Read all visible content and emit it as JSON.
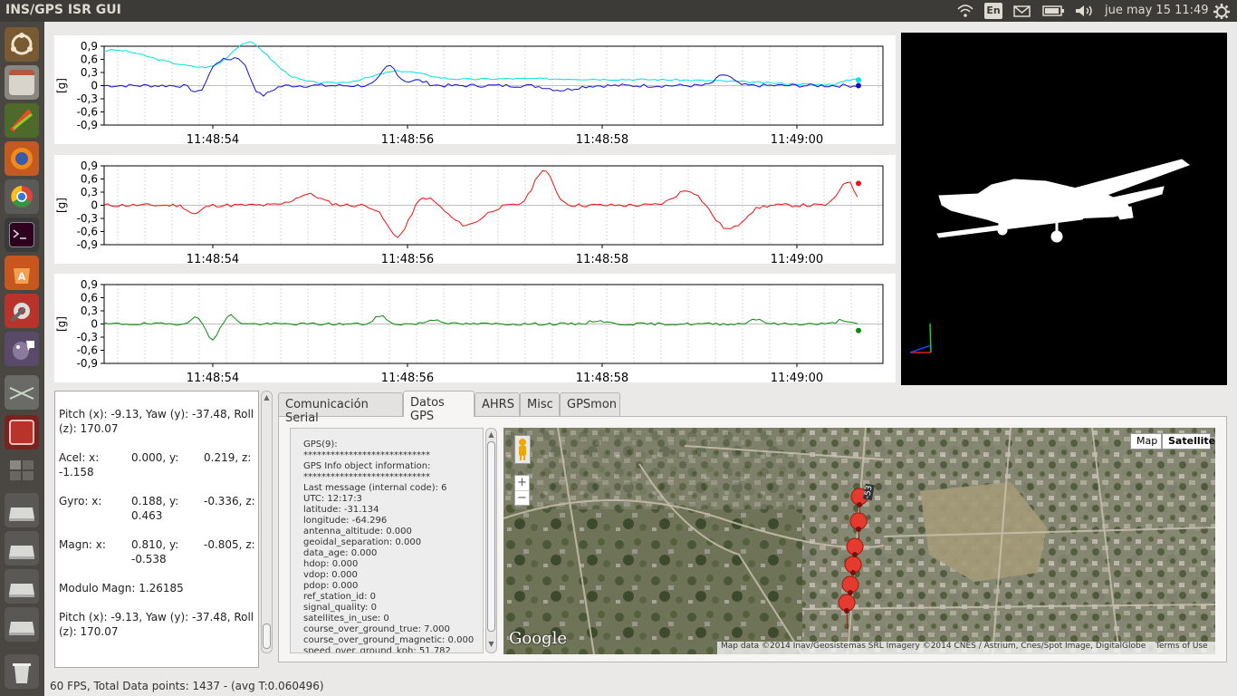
{
  "window": {
    "title": "INS/GPS ISR GUI"
  },
  "topbar": {
    "keyboard_layout": "En",
    "datetime": "jue may 15 11:49",
    "icons": [
      "wifi-icon",
      "mail-icon",
      "battery-icon",
      "volume-icon",
      "settings-gear-icon"
    ]
  },
  "launcher": {
    "items": [
      "ubuntu-dash-icon",
      "files-icon",
      "paint-icon",
      "firefox-icon",
      "chrome-icon",
      "terminal-icon",
      "software-center-icon",
      "system-settings-icon",
      "pidgin-icon",
      "scanner-icon",
      "workspace-app-icon",
      "workspace-switcher-icon",
      "drive-icon",
      "drive-icon",
      "drive-icon",
      "drive-icon",
      "trash-icon"
    ]
  },
  "plots": [
    {
      "ylabel": "[g]",
      "yticks": [
        "0,9",
        "0,6",
        "0,3",
        "0",
        "-0,3",
        "-0,6",
        "-0,9"
      ],
      "xticks": [
        "11:48:54",
        "11:48:56",
        "11:48:58",
        "11:49:00"
      ],
      "series_colors": [
        "#00e0e0",
        "#1010cc"
      ]
    },
    {
      "ylabel": "[g]",
      "yticks": [
        "0,9",
        "0,6",
        "0,3",
        "0",
        "-0,3",
        "-0,6",
        "-0,9"
      ],
      "xticks": [
        "11:48:54",
        "11:48:56",
        "11:48:58",
        "11:49:00"
      ],
      "series_colors": [
        "#ee1111"
      ]
    },
    {
      "ylabel": "[g]",
      "yticks": [
        "0,9",
        "0,6",
        "0,3",
        "0",
        "-0,3",
        "-0,6",
        "-0,9"
      ],
      "xticks": [
        "11:48:54",
        "11:48:56",
        "11:48:58",
        "11:49:00"
      ],
      "series_colors": [
        "#0a8a0a"
      ]
    }
  ],
  "info": {
    "pyr1_a": "Pitch (x): -9.13, Yaw (y): -37.48, Roll",
    "pyr1_b": "(z): 170.07",
    "acel_label": "Acel: x:",
    "acel_x": "0.000, y:",
    "acel_y": "0.219, z:",
    "acel_z": "-1.158",
    "gyro_label": "Gyro: x:",
    "gyro_x": "0.188, y:",
    "gyro_y": "-0.336, z:",
    "gyro_z": "0.463",
    "magn_label": "Magn: x:",
    "magn_x": "0.810, y:",
    "magn_y": "-0.805, z:",
    "magn_z": "-0.538",
    "modulo": "Modulo Magn: 1.26185",
    "pyr2_a": "Pitch (x): -9.13, Yaw (y): -37.48, Roll",
    "pyr2_b": "(z): 170.07"
  },
  "tabs": [
    "Comunicación Serial",
    "Datos GPS",
    "AHRS",
    "Misc",
    "GPSmon"
  ],
  "gps_lines": [
    "GPS(9):",
    "****************************",
    "GPS Info object information:",
    "****************************",
    "Last message (internal code): 6",
    "UTC: 12:17:3",
    "latitude: -31.134",
    "longitude: -64.296",
    "antenna_altitude: 0.000",
    "geoidal_separation: 0.000",
    "data_age: 0.000",
    "hdop: 0.000",
    "vdop: 0.000",
    "pdop: 0.000",
    "ref_station_id: 0",
    "signal_quality: 0",
    "satellites_in_use: 0",
    "course_over_ground_true: 7.000",
    "course_over_ground_magnetic: 0.000",
    "speed_over_ground_kph: 51.782"
  ],
  "map": {
    "type_map": "Map",
    "type_satellite": "Satellite",
    "zoom_in": "+",
    "zoom_out": "−",
    "road_label": "-53",
    "logo": "Google",
    "attribution": "Map data ©2014 Inav/Geosistemas SRL Imagery ©2014 CNES / Astrium, Cnes/Spot Image, DigitalGlobe",
    "terms": "Terms of Use"
  },
  "status": "60 FPS, Total Data points: 1437 - (avg T:0.060496)"
}
